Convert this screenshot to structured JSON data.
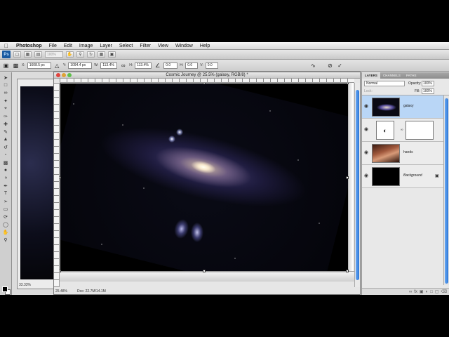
{
  "menubar": {
    "app": "Photoshop",
    "items": [
      "File",
      "Edit",
      "Image",
      "Layer",
      "Select",
      "Filter",
      "View",
      "Window",
      "Help"
    ]
  },
  "appbar": {
    "logo": "Ps",
    "zoom": "100%"
  },
  "options": {
    "x_label": "X:",
    "x_value": "1608.5 px",
    "y_label": "Y:",
    "y_value": "1094.4 px",
    "w_label": "W:",
    "w_value": "113.4%",
    "h_label": "H:",
    "h_value": "113.4%",
    "angle_value": "0.0",
    "hskew_label": "H:",
    "hskew_value": "0.0",
    "vskew_label": "V:",
    "vskew_value": "0.0"
  },
  "document": {
    "title": "Cosmic Journey @ 25.5% (galaxy, RGB/8) *",
    "zoom": "25.48%",
    "doc_size": "Doc: 22.7M/14.1M"
  },
  "background_document": {
    "zoom": "33.33%"
  },
  "layers_panel": {
    "tabs": [
      "LAYERS",
      "CHANNELS",
      "PATHS"
    ],
    "blend_mode": "Normal",
    "opacity_label": "Opacity:",
    "opacity_value": "100%",
    "lock_label": "Lock:",
    "fill_label": "Fill:",
    "fill_value": "100%",
    "layers": [
      {
        "name": "galaxy",
        "selected": true
      },
      {
        "name": "",
        "selected": false
      },
      {
        "name": "hands",
        "selected": false
      },
      {
        "name": "Background",
        "selected": false
      }
    ]
  },
  "colors": {
    "selection_blue": "#b9d6f6",
    "scroll_blue": "#2c76d7",
    "close_red": "#e0443e",
    "min_yellow": "#dea236",
    "max_green": "#5ec04a"
  }
}
